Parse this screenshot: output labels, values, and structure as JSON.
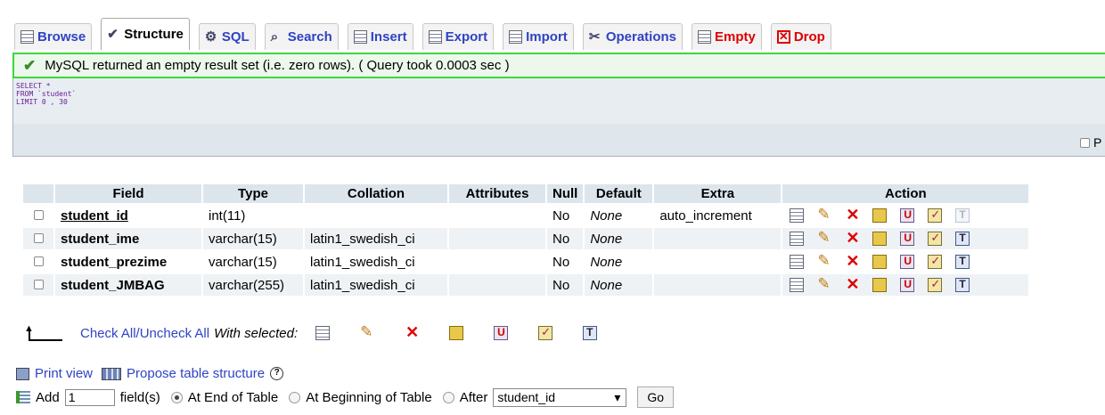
{
  "tabs": [
    {
      "label": "Browse",
      "icon": "browse-icon"
    },
    {
      "label": "Structure",
      "icon": "structure-icon"
    },
    {
      "label": "SQL",
      "icon": "sql-icon"
    },
    {
      "label": "Search",
      "icon": "search-icon"
    },
    {
      "label": "Insert",
      "icon": "insert-icon"
    },
    {
      "label": "Export",
      "icon": "export-icon"
    },
    {
      "label": "Import",
      "icon": "import-icon"
    },
    {
      "label": "Operations",
      "icon": "operations-icon"
    },
    {
      "label": "Empty",
      "icon": "empty-icon"
    },
    {
      "label": "Drop",
      "icon": "drop-icon"
    }
  ],
  "message": "MySQL returned an empty result set (i.e. zero rows). ( Query took 0.0003 sec )",
  "sql": {
    "line1": "SELECT *",
    "line2": "FROM `student`",
    "line3": "LIMIT 0 , 30",
    "profiling_label": "P"
  },
  "table": {
    "headers": {
      "field": "Field",
      "type": "Type",
      "collation": "Collation",
      "attributes": "Attributes",
      "null": "Null",
      "default": "Default",
      "extra": "Extra",
      "action": "Action"
    },
    "rows": [
      {
        "field": "student_id",
        "type": "int(11)",
        "collation": "",
        "attributes": "",
        "null": "No",
        "default": "None",
        "extra": "auto_increment"
      },
      {
        "field": "student_ime",
        "type": "varchar(15)",
        "collation": "latin1_swedish_ci",
        "attributes": "",
        "null": "No",
        "default": "None",
        "extra": ""
      },
      {
        "field": "student_prezime",
        "type": "varchar(15)",
        "collation": "latin1_swedish_ci",
        "attributes": "",
        "null": "No",
        "default": "None",
        "extra": ""
      },
      {
        "field": "student_JMBAG",
        "type": "varchar(255)",
        "collation": "latin1_swedish_ci",
        "attributes": "",
        "null": "No",
        "default": "None",
        "extra": ""
      }
    ]
  },
  "footer": {
    "check_all": "Check All",
    "separator": " / ",
    "uncheck_all": "Uncheck All",
    "with_selected": "With selected:"
  },
  "links": {
    "print_view": "Print view",
    "propose": "Propose table structure"
  },
  "add_field": {
    "add_label": "Add",
    "count_value": "1",
    "fields_label": "field(s)",
    "at_end": "At End of Table",
    "at_beginning": "At Beginning of Table",
    "after": "After",
    "after_select": "student_id",
    "go": "Go"
  }
}
